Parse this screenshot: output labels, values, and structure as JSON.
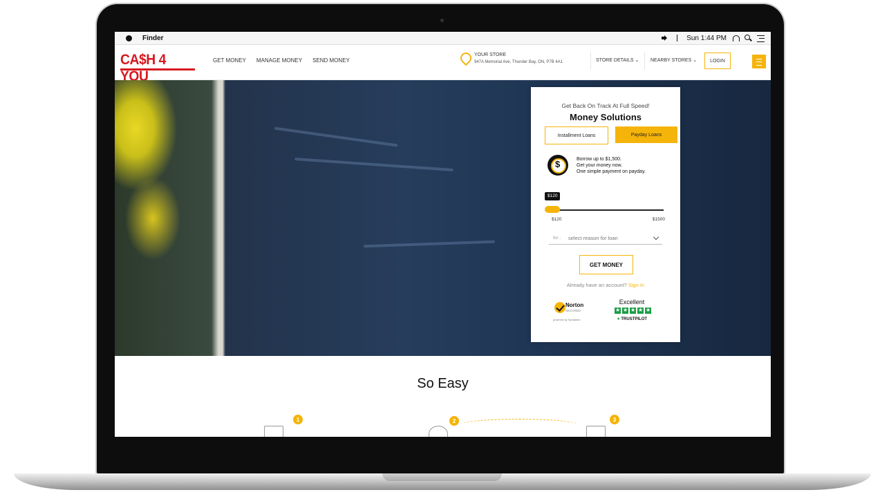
{
  "menubar": {
    "app": "Finder",
    "clock": "Sun 1:44 PM"
  },
  "nav": {
    "logo_text": "CA$H 4 YOU",
    "links": [
      "GET MONEY",
      "MANAGE MONEY",
      "SEND MONEY"
    ],
    "store_title": "YOUR STORE",
    "store_address": "947A Memorial Ave, Thunder Bay, ON, P7B 4A1",
    "store_details": "STORE DETAILS",
    "nearby_stores": "NEARBY STORES",
    "login": "LOGIN"
  },
  "form": {
    "kicker": "Get Back On Track At Full Speed!",
    "title": "Money Solutions",
    "tabs": [
      {
        "label": "Installment Loans",
        "active": false
      },
      {
        "label": "Payday Loans",
        "active": true
      }
    ],
    "pitch": [
      "Borrow up to $1,500.",
      "Get your money now.",
      "One simple payment on payday."
    ],
    "slider": {
      "value_label": "$120",
      "min_label": "$120",
      "max_label": "$1500",
      "min": 120,
      "max": 1500,
      "value": 120
    },
    "reason_prefix": "for :",
    "reason_placeholder": "select reason for loan",
    "submit": "GET MONEY",
    "signin_prompt": "Already have an account?",
    "signin_link": "Sign In",
    "norton_name": "Norton",
    "norton_sub": "SECURED",
    "norton_powered": "powered by Symantec",
    "trust_rating": "Excellent",
    "trust_brand": "TRUSTPILOT"
  },
  "section": {
    "title": "So Easy",
    "steps": [
      "1",
      "2",
      "3"
    ]
  },
  "colors": {
    "accent": "#f5b40a",
    "brand_red": "#d71920",
    "trust_green": "#1a9d46"
  }
}
